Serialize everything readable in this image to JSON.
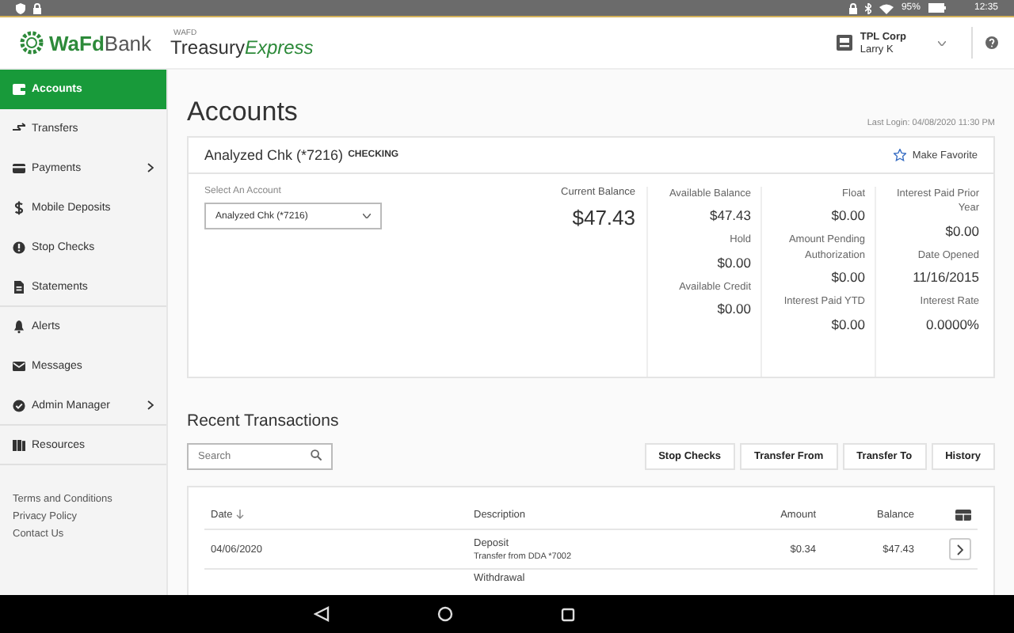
{
  "status_bar": {
    "battery": "95%",
    "time": "12:35"
  },
  "header": {
    "brand": "WaFd",
    "brand_suffix": "Bank",
    "product_small": "WAFD",
    "product_main": "Treasury",
    "product_italic": "Express",
    "company": "TPL Corp",
    "user": "Larry K"
  },
  "sidebar": {
    "items": [
      {
        "label": "Accounts",
        "selected": true,
        "has_submenu": false
      },
      {
        "label": "Transfers",
        "selected": false,
        "has_submenu": false
      },
      {
        "label": "Payments",
        "selected": false,
        "has_submenu": true
      },
      {
        "label": "Mobile Deposits",
        "selected": false,
        "has_submenu": false
      },
      {
        "label": "Stop Checks",
        "selected": false,
        "has_submenu": false
      },
      {
        "label": "Statements",
        "selected": false,
        "has_submenu": false
      },
      {
        "label": "Alerts",
        "selected": false,
        "has_submenu": false
      },
      {
        "label": "Messages",
        "selected": false,
        "has_submenu": false
      },
      {
        "label": "Admin Manager",
        "selected": false,
        "has_submenu": true
      },
      {
        "label": "Resources",
        "selected": false,
        "has_submenu": false
      }
    ],
    "links": [
      "Terms and Conditions",
      "Privacy Policy",
      "Contact Us"
    ]
  },
  "page": {
    "title": "Accounts",
    "last_login": "Last Login: 04/08/2020 11:30 PM"
  },
  "account": {
    "name": "Analyzed Chk (*7216)",
    "type": "CHECKING",
    "favorite_label": "Make Favorite",
    "favorite": false,
    "select_label": "Select An Account",
    "selected_account": "Analyzed Chk (*7216)",
    "current_balance_label": "Current Balance",
    "current_balance": "$47.43",
    "columns": [
      [
        {
          "label": "Available Balance",
          "value": "$47.43"
        },
        {
          "label": "Hold",
          "value": "$0.00"
        },
        {
          "label": "Available Credit",
          "value": "$0.00"
        }
      ],
      [
        {
          "label": "Float",
          "value": "$0.00"
        },
        {
          "label": "Amount Pending Authorization",
          "value": "$0.00"
        },
        {
          "label": "Interest Paid YTD",
          "value": "$0.00"
        }
      ],
      [
        {
          "label": "Interest Paid Prior Year",
          "value": "$0.00"
        },
        {
          "label": "Date Opened",
          "value": "11/16/2015"
        },
        {
          "label": "Interest Rate",
          "value": "0.0000%"
        }
      ]
    ]
  },
  "transactions": {
    "title": "Recent Transactions",
    "search": {
      "placeholder": "Search"
    },
    "actions": [
      "Stop Checks",
      "Transfer From",
      "Transfer To",
      "History"
    ],
    "columns": [
      {
        "label": "Date",
        "sorted_descending": true
      },
      {
        "label": "Description",
        "sorted_descending": false
      },
      {
        "label": "Amount",
        "sorted_descending": false
      },
      {
        "label": "Balance",
        "sorted_descending": false
      }
    ],
    "rows": [
      {
        "date": "04/06/2020",
        "description": "Deposit",
        "detail": "Transfer from DDA *7002",
        "amount": "$0.34",
        "balance": "$47.43"
      },
      {
        "description": "Withdrawal"
      }
    ]
  }
}
